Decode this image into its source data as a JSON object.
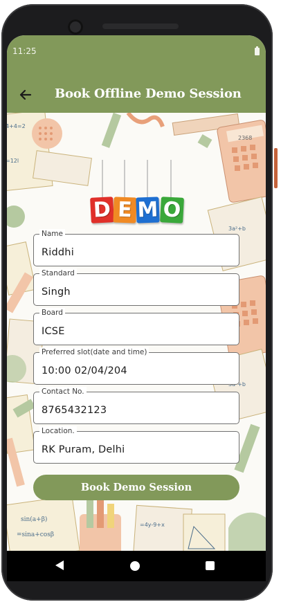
{
  "status_bar": {
    "time": "11:25"
  },
  "app_bar": {
    "title": "Book Offline Demo Session"
  },
  "banner": {
    "letters": [
      "D",
      "E",
      "M",
      "O"
    ],
    "colors": [
      "#e0302a",
      "#f08a24",
      "#1e6fd1",
      "#3aa83a"
    ]
  },
  "form": {
    "fields": [
      {
        "label": "Name",
        "value": "Riddhi"
      },
      {
        "label": "Standard",
        "value": "Singh"
      },
      {
        "label": "Board",
        "value": "ICSE"
      },
      {
        "label": "Preferred slot(date and time)",
        "value": "10:00 02/04/204"
      },
      {
        "label": "Contact No.",
        "value": "8765432123"
      },
      {
        "label": "Location.",
        "value": "RK Puram, Delhi"
      }
    ],
    "submit_label": "Book Demo Session"
  },
  "colors": {
    "primary": "#82995a",
    "background": "#fbfaf6"
  }
}
